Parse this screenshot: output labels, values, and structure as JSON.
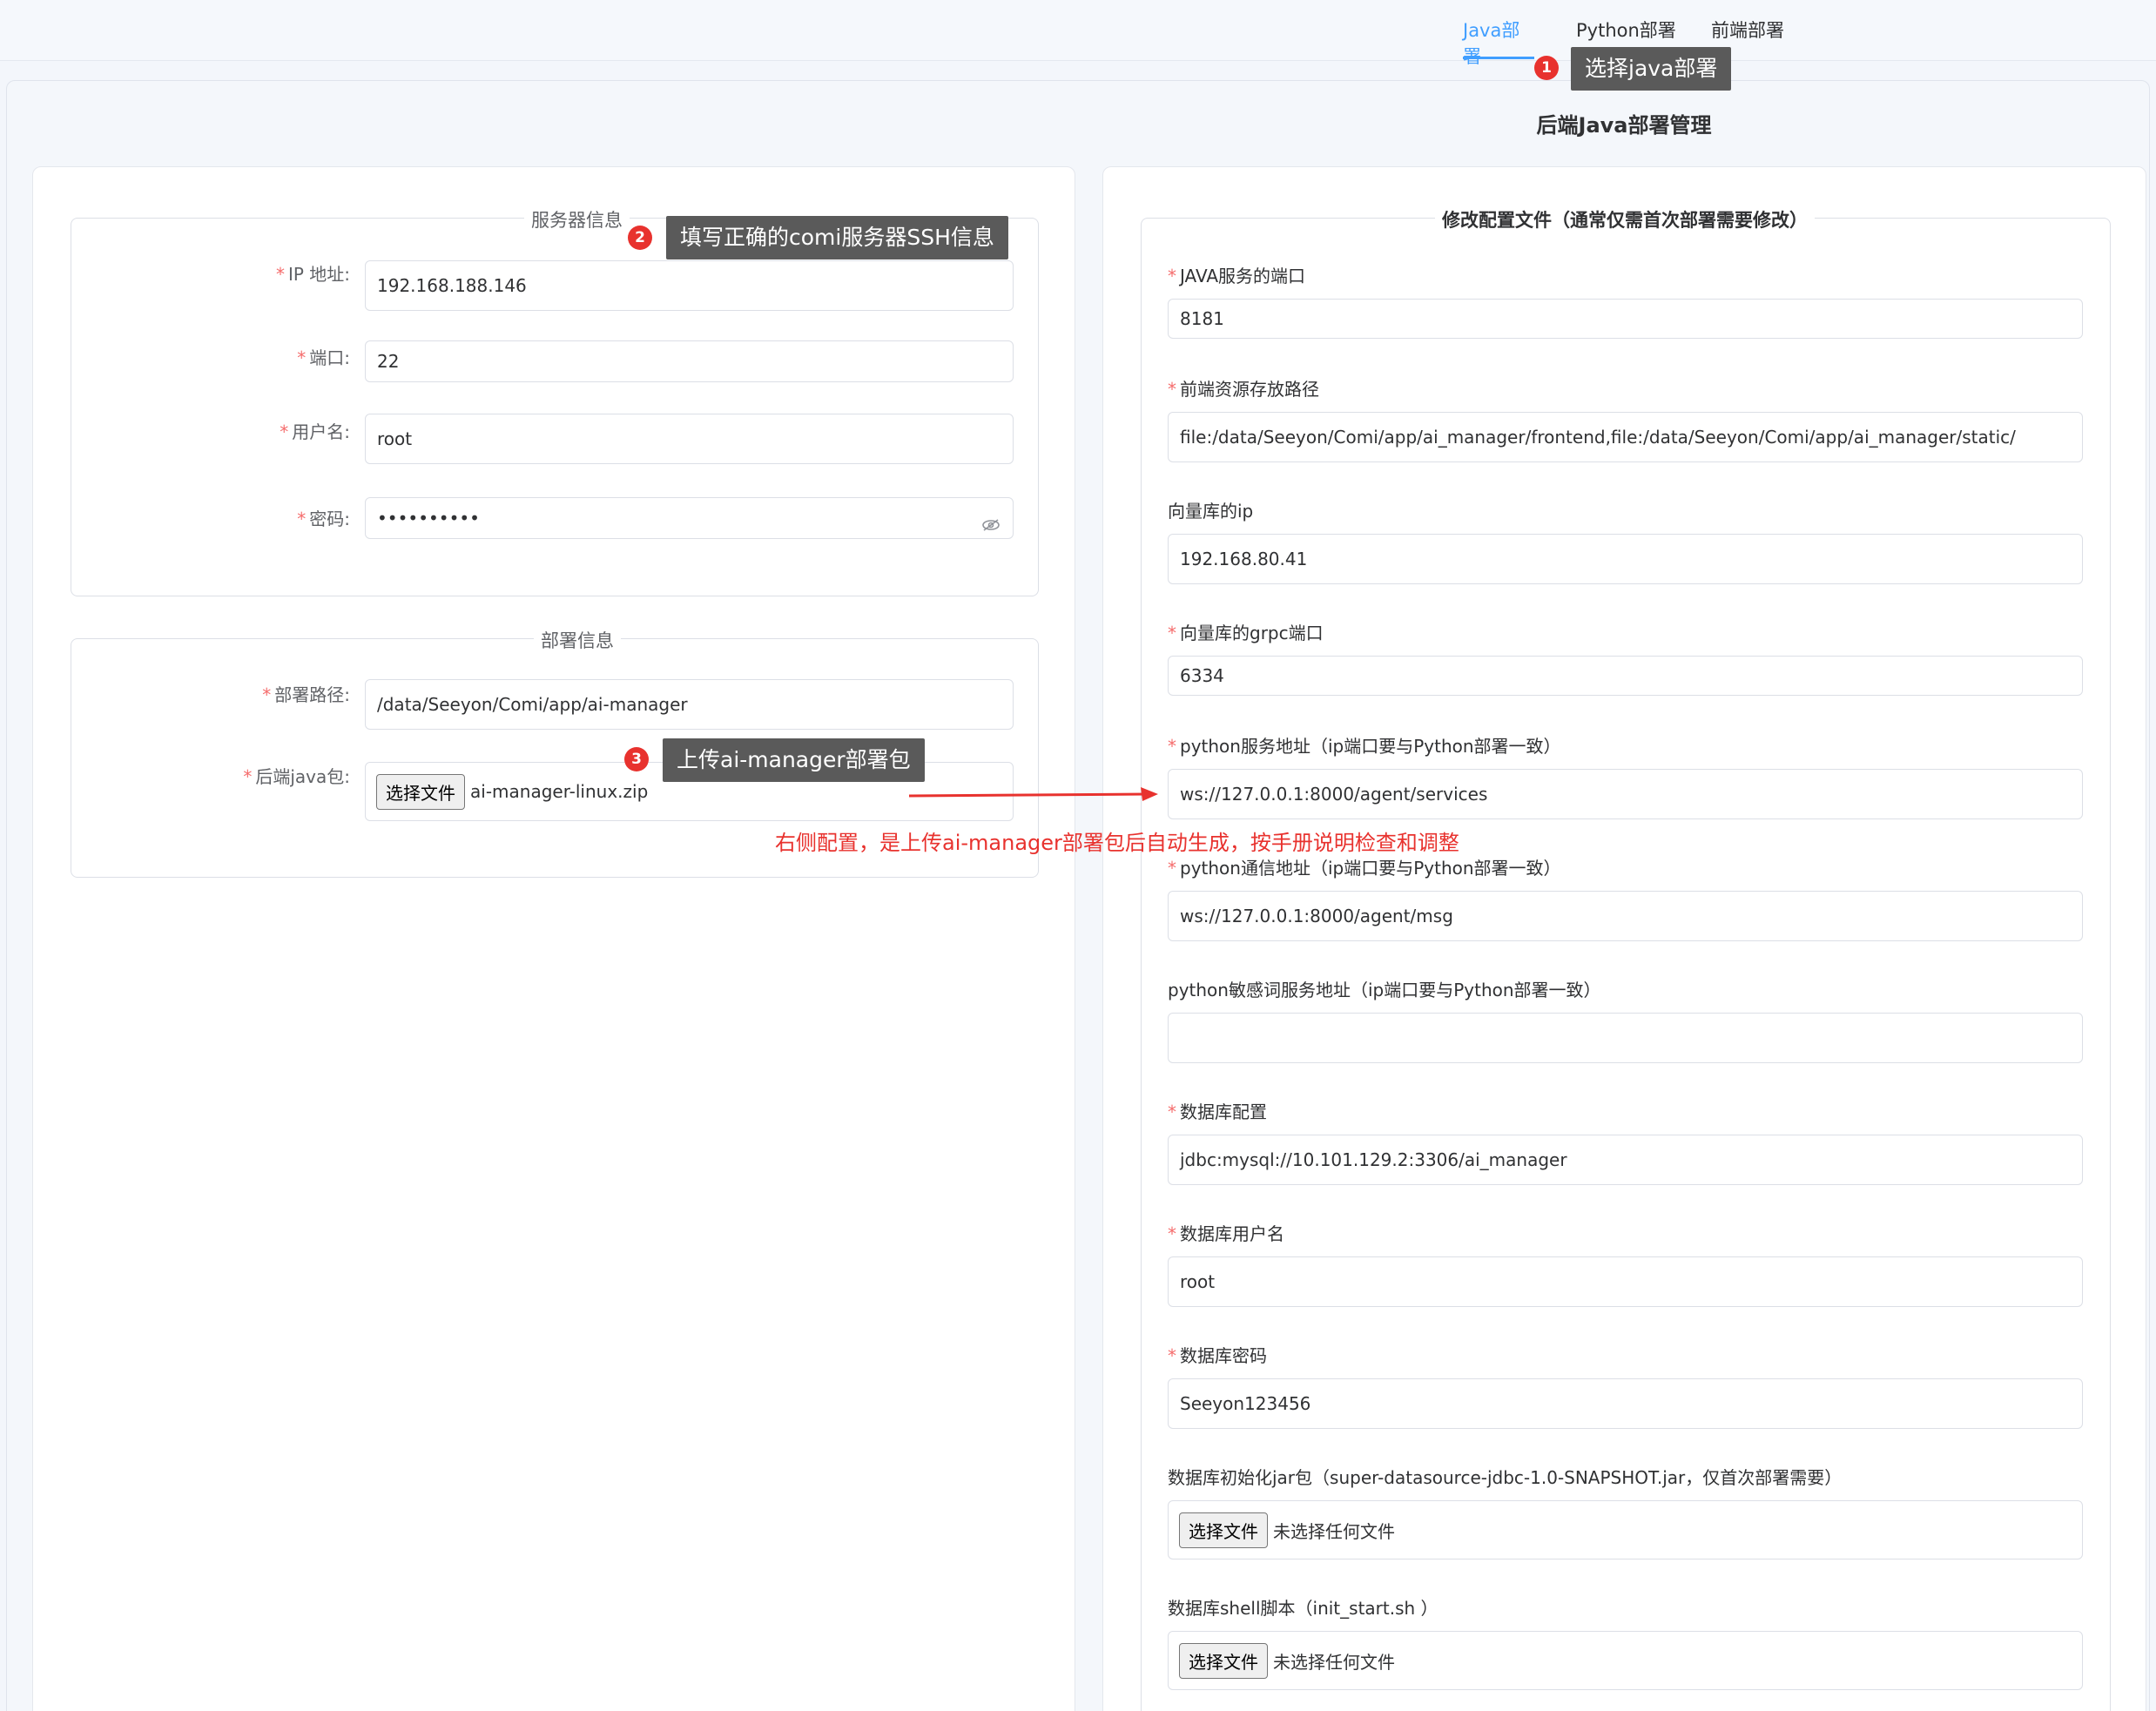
{
  "tabs": [
    {
      "label": "Java部署",
      "active": true
    },
    {
      "label": "Python部署",
      "active": false
    },
    {
      "label": "前端部署",
      "active": false
    }
  ],
  "page_title": "后端Java部署管理",
  "server_info": {
    "legend": "服务器信息",
    "ip_label": "IP 地址:",
    "ip_value": "192.168.188.146",
    "port_label": "端口:",
    "port_value": "22",
    "user_label": "用户名:",
    "user_value": "root",
    "password_label": "密码:",
    "password_value": "••••••••••"
  },
  "deploy_info": {
    "legend": "部署信息",
    "path_label": "部署路径:",
    "path_value": "/data/Seeyon/Comi/app/ai-manager",
    "package_label": "后端java包:",
    "choose_file": "选择文件",
    "package_file": "ai-manager-linux.zip"
  },
  "config": {
    "legend": "修改配置文件（通常仅需首次部署需要修改）",
    "fields": [
      {
        "label": "JAVA服务的端口",
        "required": true,
        "value": "8181"
      },
      {
        "label": "前端资源存放路径",
        "required": true,
        "value": "file:/data/Seeyon/Comi/app/ai_manager/frontend,file:/data/Seeyon/Comi/app/ai_manager/static/"
      },
      {
        "label": "向量库的ip",
        "required": false,
        "value": "192.168.80.41"
      },
      {
        "label": "向量库的grpc端口",
        "required": true,
        "value": "6334"
      },
      {
        "label": "python服务地址（ip端口要与Python部署一致）",
        "required": true,
        "value": "ws://127.0.0.1:8000/agent/services"
      },
      {
        "label": "python通信地址（ip端口要与Python部署一致）",
        "required": true,
        "value": "ws://127.0.0.1:8000/agent/msg"
      },
      {
        "label": "python敏感词服务地址（ip端口要与Python部署一致）",
        "required": false,
        "value": ""
      },
      {
        "label": "数据库配置",
        "required": true,
        "value": "jdbc:mysql://10.101.129.2:3306/ai_manager"
      },
      {
        "label": "数据库用户名",
        "required": true,
        "value": "root"
      },
      {
        "label": "数据库密码",
        "required": true,
        "value": "Seeyon123456"
      }
    ],
    "jar_label": "数据库初始化jar包（super-datasource-jdbc-1.0-SNAPSHOT.jar，仅首次部署需要）",
    "shell_label": "数据库shell脚本（init_start.sh ）",
    "choose_file": "选择文件",
    "no_file": "未选择任何文件"
  },
  "annotations": {
    "callout1": "选择java部署",
    "callout2": "填写正确的comi服务器SSH信息",
    "callout3": "上传ai-manager部署包",
    "note": "右侧配置，是上传ai-manager部署包后自动生成，按手册说明检查和调整",
    "n1": "1",
    "n2": "2",
    "n3": "3",
    "color": "#e8322e"
  }
}
